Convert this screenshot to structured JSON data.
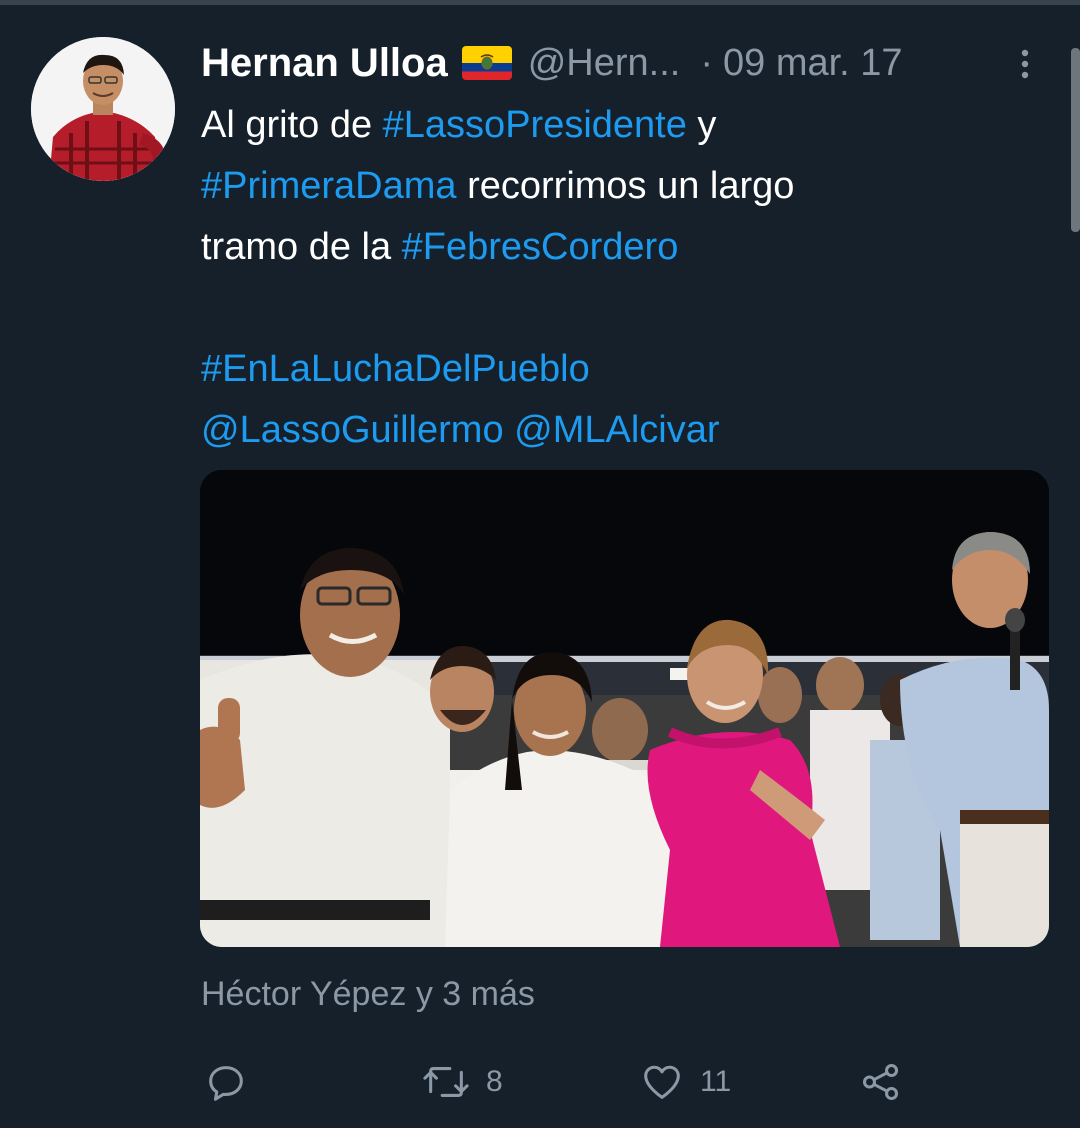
{
  "tweet": {
    "display_name": "Hernan Ulloa",
    "handle": "@Hern...",
    "separator": "·",
    "date": "09 mar. 17",
    "flag_icon": "ecuador-flag-icon",
    "text": {
      "line1_pre": "Al grito de ",
      "line1_tag": "#LassoPresidente",
      "line1_post": " y",
      "line2_tag": "#PrimeraDama",
      "line2_post": " recorrimos un largo",
      "line3_pre": "tramo de la ",
      "line3_tag": "#FebresCordero",
      "line5_tag": "#EnLaLuchaDelPueblo",
      "line6_mention1": "@LassoGuillermo",
      "line6_mention2": "@MLAlcivar"
    },
    "tagged_people": "Héctor Yépez y 3 más"
  },
  "actions": {
    "reply": {
      "icon": "reply-icon",
      "count": ""
    },
    "retweet": {
      "icon": "retweet-icon",
      "count": "8"
    },
    "like": {
      "icon": "heart-icon",
      "count": "11"
    },
    "share": {
      "icon": "share-icon"
    }
  },
  "colors": {
    "background": "#15202b",
    "link": "#1d9bf0",
    "secondary_text": "#8b98a5",
    "primary_text": "#ffffff",
    "dress_accent": "#e0187e"
  }
}
